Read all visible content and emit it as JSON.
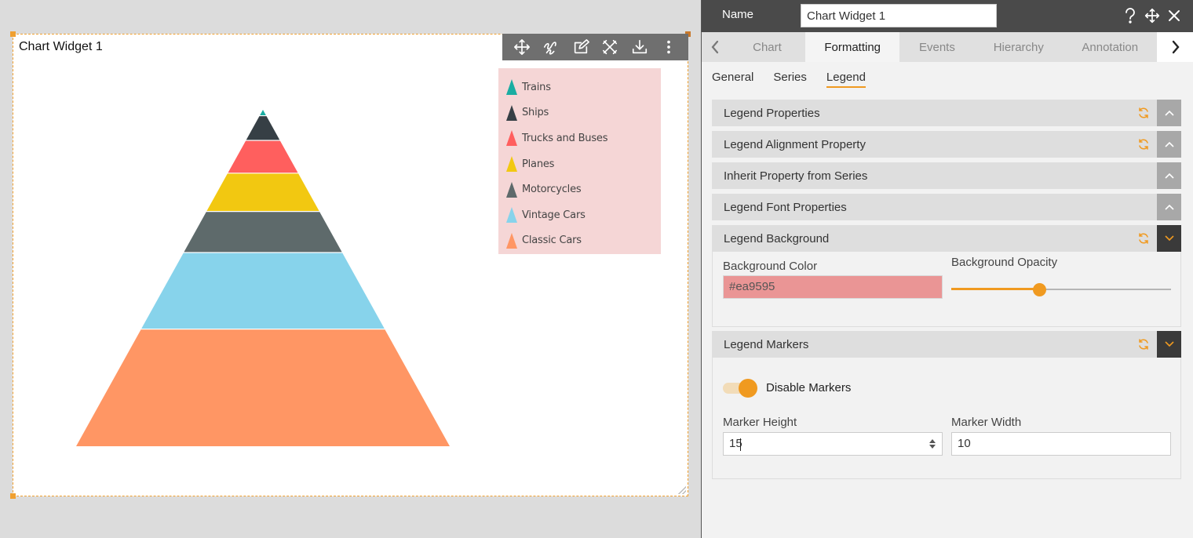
{
  "widget": {
    "title": "Chart Widget 1",
    "toolbar": [
      "move-icon",
      "wand-icon",
      "edit-icon",
      "tools-icon",
      "download-icon",
      "more-vertical-icon"
    ]
  },
  "chart_data": {
    "type": "pyramid",
    "categories": [
      "Trains",
      "Ships",
      "Trucks and Buses",
      "Planes",
      "Motorcycles",
      "Vintage Cars",
      "Classic Cars"
    ],
    "values": [
      2,
      9,
      12,
      14,
      15,
      28,
      43
    ],
    "colors": [
      "#1aada2",
      "#363f45",
      "#ff5f5e",
      "#f2c811",
      "#5e6a6b",
      "#87d3eb",
      "#ff9664"
    ],
    "legend_background": "#f5d6d6",
    "legend_position": "top-right"
  },
  "panel": {
    "name_label": "Name",
    "name_value": "Chart Widget 1",
    "header_icons": [
      "help-icon",
      "move-icon",
      "close-icon"
    ],
    "tabs": [
      "Chart",
      "Formatting",
      "Events",
      "Hierarchy",
      "Annotation"
    ],
    "active_tab": "Formatting",
    "subtabs": [
      "General",
      "Series",
      "Legend"
    ],
    "active_subtab": "Legend",
    "sections": {
      "legend_properties": "Legend Properties",
      "legend_alignment": "Legend Alignment Property",
      "inherit_series": "Inherit Property from Series",
      "legend_font": "Legend Font Properties",
      "legend_background": "Legend Background",
      "legend_markers": "Legend Markers"
    },
    "background": {
      "color_label": "Background Color",
      "color_value": "#ea9595",
      "opacity_label": "Background Opacity",
      "opacity": 0.4
    },
    "markers": {
      "disable_label": "Disable Markers",
      "disable_on": true,
      "height_label": "Marker Height",
      "height_value": "15",
      "width_label": "Marker Width",
      "width_value": "10"
    },
    "accent": "#f09a20"
  }
}
